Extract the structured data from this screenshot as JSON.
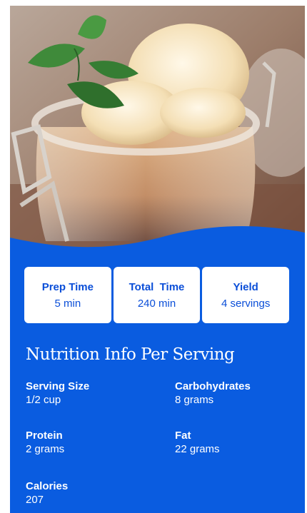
{
  "hero": {
    "image": "ice-cream-jar-photo"
  },
  "stats": [
    {
      "label": "Prep Time",
      "value": "5 min"
    },
    {
      "label": "Total  Time",
      "value": "240 min"
    },
    {
      "label": "Yield",
      "value": "4 servings"
    }
  ],
  "nutrition": {
    "title": "Nutrition Info Per Serving",
    "items": [
      {
        "label": "Serving Size",
        "value": "1/2 cup"
      },
      {
        "label": "Carbohydrates",
        "value": "8 grams"
      },
      {
        "label": "Protein",
        "value": "2 grams"
      },
      {
        "label": "Fat",
        "value": "22 grams"
      },
      {
        "label": "Calories",
        "value": "207"
      }
    ]
  },
  "colors": {
    "accent": "#0a5ce0",
    "text_on_accent": "#ffffff",
    "stat_text": "#0a4ed8"
  }
}
